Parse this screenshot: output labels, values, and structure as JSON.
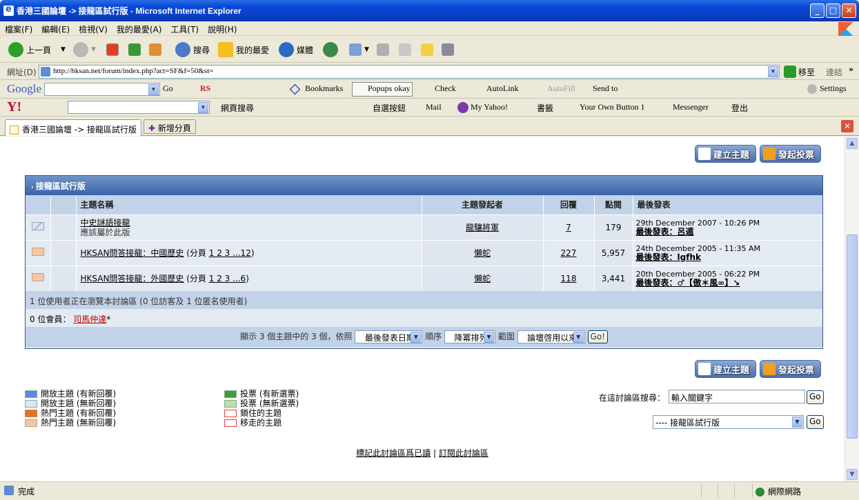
{
  "window": {
    "title": "香港三國論壇 -> 接龍區試行版 - Microsoft Internet Explorer"
  },
  "menu": [
    "檔案(F)",
    "編輯(E)",
    "檢視(V)",
    "我的最愛(A)",
    "工具(T)",
    "說明(H)"
  ],
  "toolbar": {
    "back": "上一頁",
    "search": "搜尋",
    "favorites": "我的最愛",
    "media": "媒體"
  },
  "address": {
    "label": "網址(D)",
    "url": "http://hksan.net/forum/index.php?act=SF&f=50&st=",
    "go": "移至",
    "links": "連結"
  },
  "google": {
    "brand": "Google",
    "go": "Go",
    "rs": "RS",
    "bookmarks": "Bookmarks",
    "popups": "Popups okay",
    "check": "Check",
    "autolink": "AutoLink",
    "autofill": "AutoFill",
    "sendto": "Send to",
    "settings": "Settings"
  },
  "yahoo": {
    "search": "網頁搜尋",
    "auto_btn": "自選按鈕",
    "mail": "Mail",
    "myyahoo": "My Yahoo!",
    "bookmarks": "書籤",
    "own_button": "Your Own Button 1",
    "messenger": "Messenger",
    "logout": "登出"
  },
  "tabs": [
    {
      "label": "香港三國論壇 -> 接龍區試行版"
    },
    {
      "label": "新增分頁"
    }
  ],
  "actions": {
    "new_topic": "建立主題",
    "new_poll": "發起投票"
  },
  "forum": {
    "title": "接龍區試行版",
    "headers": {
      "topic": "主題名稱",
      "starter": "主題發起者",
      "replies": "回覆",
      "views": "點閱",
      "last": "最後發表"
    },
    "topics": [
      {
        "title": "中史謎語接龍",
        "desc": "應該屬於此版",
        "pages_label": "",
        "pages": "",
        "starter": "龍驤將軍",
        "replies": "7",
        "views": "179",
        "last_date": "29th December 2007 - 10:26 PM",
        "last_label": "最後發表：",
        "last_user": "呂遁"
      },
      {
        "title": "HKSAN問答接龍：中國歷史",
        "desc": "",
        "pages_label": "(分頁",
        "pages": "1 2 3 ...12",
        "starter": "懶蛇",
        "replies": "227",
        "views": "5,957",
        "last_date": "24th December 2005 - 11:35 AM",
        "last_label": "最後發表：",
        "last_user": "lgfhk"
      },
      {
        "title": "HKSAN問答接龍：外國歷史",
        "desc": "",
        "pages_label": "(分頁",
        "pages": "1 2 3 ...6",
        "starter": "懶蛇",
        "replies": "118",
        "views": "3,441",
        "last_date": "20th December 2005 - 06:22 PM",
        "last_label": "最後發表：",
        "last_user": "♂【傲＊風∞】↘"
      }
    ],
    "online": "1 位使用者正在瀏覽本討論區 (0 位訪客及 1 位匿名使用者)",
    "members_label": "0 位會員：",
    "member": "司馬仲達",
    "member_suffix": "*",
    "sort_prefix": "顯示 3 個主題中的 3 個，依照",
    "sort_by": "最後發表日期",
    "order_label": "順序",
    "order": "降冪排列",
    "range_label": "範圍",
    "range": "論壇啓用以來",
    "go": "Go!"
  },
  "legend": {
    "left": [
      "開放主題 (有新回覆)",
      "開放主題 (無新回覆)",
      "熱門主題 (有新回覆)",
      "熱門主題 (無新回覆)"
    ],
    "right": [
      "投票 (有新選票)",
      "投票 (無新選票)",
      "鎖住的主題",
      "移走的主題"
    ]
  },
  "search": {
    "label": "在這討論區搜尋：",
    "value": "輸入關鍵字",
    "go": "Go",
    "jump": "---- 接龍區試行版",
    "jump_go": "Go"
  },
  "footer": {
    "mark_read": "標記此討論區爲已讀",
    "sep": "|",
    "subscribe": "訂閱此討論區"
  },
  "status": {
    "text": "完成",
    "zone": "網際網路"
  }
}
